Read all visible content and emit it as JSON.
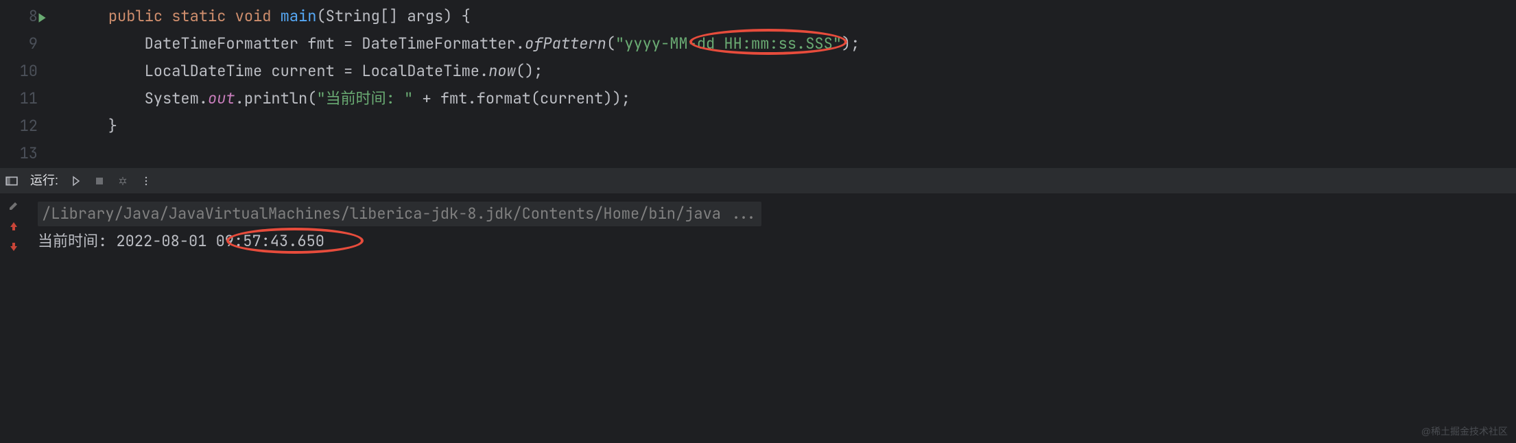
{
  "editor": {
    "lines": [
      {
        "num": "8"
      },
      {
        "num": "9"
      },
      {
        "num": "10"
      },
      {
        "num": "11"
      },
      {
        "num": "12"
      },
      {
        "num": "13"
      }
    ],
    "code": {
      "l8_public": "public",
      "l8_static": "static",
      "l8_void": "void",
      "l8_main": "main",
      "l8_rest": "(String[] args) {",
      "l9_a": "        DateTimeFormatter fmt = DateTimeFormatter.",
      "l9_ofPattern": "ofPattern",
      "l9_open": "(",
      "l9_str": "\"yyyy-MM-dd HH:mm:ss.SSS\"",
      "l9_close": ");",
      "l10_a": "        LocalDateTime current = LocalDateTime.",
      "l10_now": "now",
      "l10_rest": "();",
      "l11_a": "        System.",
      "l11_out": "out",
      "l11_b": ".println(",
      "l11_str": "\"当前时间: \"",
      "l11_c": " + fmt.format(current));",
      "l12": "    }"
    }
  },
  "toolbar": {
    "run_label": "运行:"
  },
  "console": {
    "command": "/Library/Java/JavaVirtualMachines/liberica-jdk-8.jdk/Contents/Home/bin/java ...",
    "output_prefix": "当前时间: ",
    "output_date": "2022-08-01 ",
    "output_time": "09:57:43.650"
  },
  "watermark": "@稀土掘金技术社区"
}
